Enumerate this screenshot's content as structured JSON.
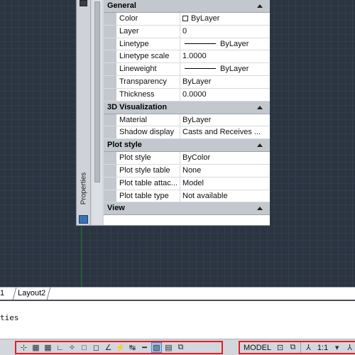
{
  "palette": {
    "title": "Properties",
    "sections": [
      {
        "name": "General",
        "rows": [
          {
            "label": "Color",
            "value": "ByLayer",
            "kind": "color"
          },
          {
            "label": "Layer",
            "value": "0"
          },
          {
            "label": "Linetype",
            "value": "ByLayer",
            "kind": "line"
          },
          {
            "label": "Linetype scale",
            "value": "1.0000"
          },
          {
            "label": "Lineweight",
            "value": "ByLayer",
            "kind": "line"
          },
          {
            "label": "Transparency",
            "value": "ByLayer"
          },
          {
            "label": "Thickness",
            "value": "0.0000"
          }
        ]
      },
      {
        "name": "3D Visualization",
        "rows": [
          {
            "label": "Material",
            "value": "ByLayer"
          },
          {
            "label": "Shadow display",
            "value": "Casts and Receives ..."
          }
        ]
      },
      {
        "name": "Plot style",
        "rows": [
          {
            "label": "Plot style",
            "value": "ByColor"
          },
          {
            "label": "Plot style table",
            "value": "None"
          },
          {
            "label": "Plot table attac...",
            "value": "Model"
          },
          {
            "label": "Plot table type",
            "value": "Not available"
          }
        ]
      },
      {
        "name": "View",
        "rows": []
      }
    ]
  },
  "tabs": {
    "model_fragment": "1",
    "layout2": "Layout2"
  },
  "command": {
    "history": "ties"
  },
  "status": {
    "model_label": "MODEL",
    "annotation_scale": "1:1",
    "left_icons": [
      "infer-constraints-icon",
      "snap-icon",
      "grid-icon",
      "ortho-icon",
      "polar-icon",
      "object-snap-icon",
      "3d-object-snap-icon",
      "object-snap-tracking-icon",
      "dynamic-ucs-icon",
      "dynamic-input-icon",
      "lineweight-icon",
      "transparency-icon",
      "quick-properties-icon",
      "selection-cycling-icon"
    ],
    "right_icons": [
      "model-space-icon",
      "quick-view-layouts-icon",
      "annotation-scale-icon"
    ]
  },
  "colors": {
    "canvas": "#2b3441",
    "highlight_border": "#e0202a"
  }
}
